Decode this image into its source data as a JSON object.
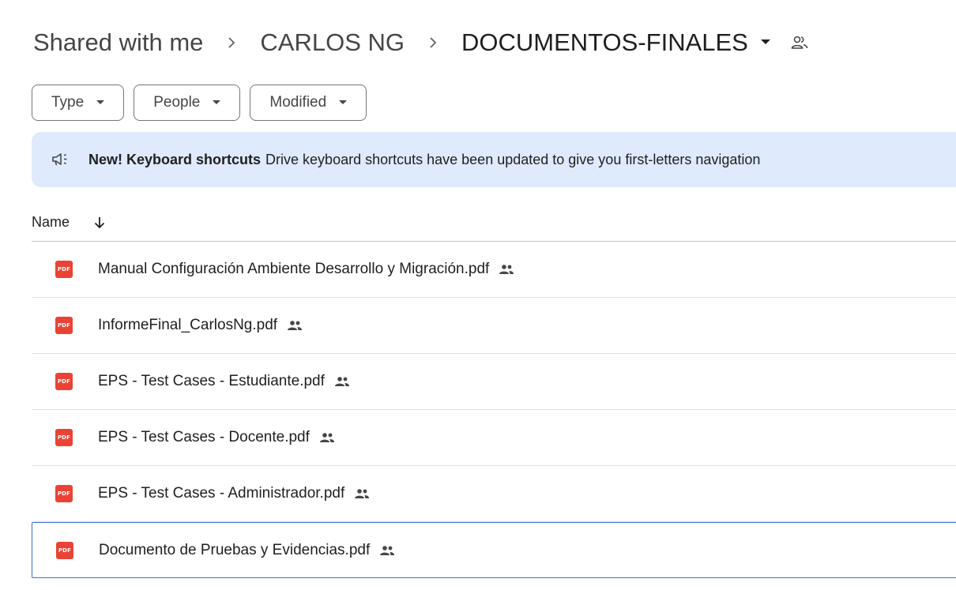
{
  "breadcrumb": {
    "items": [
      "Shared with me",
      "CARLOS NG",
      "DOCUMENTOS-FINALES"
    ],
    "separator": "›"
  },
  "filters": [
    {
      "label": "Type"
    },
    {
      "label": "People"
    },
    {
      "label": "Modified"
    }
  ],
  "banner": {
    "title": "New! Keyboard shortcuts",
    "text": "Drive keyboard shortcuts have been updated to give you first-letters navigation"
  },
  "list": {
    "header_name": "Name",
    "file_icon_text": "PDF",
    "files": [
      {
        "name": "Manual Configuración Ambiente Desarrollo y Migración.pdf"
      },
      {
        "name": "InformeFinal_CarlosNg.pdf"
      },
      {
        "name": "EPS - Test Cases - Estudiante.pdf"
      },
      {
        "name": "EPS - Test Cases - Docente.pdf"
      },
      {
        "name": "EPS - Test Cases - Administrador.pdf"
      },
      {
        "name": "Documento de Pruebas y Evidencias.pdf"
      }
    ]
  },
  "colors": {
    "banner_bg": "#dfeafc",
    "pdf_red": "#ea4335",
    "selected_border": "#3c6fd0"
  },
  "icons": [
    "chevron-right-icon",
    "dropdown-caret-icon",
    "people-outline-icon",
    "announcement-icon",
    "arrow-down-icon",
    "pdf-file-icon",
    "shared-people-icon"
  ]
}
